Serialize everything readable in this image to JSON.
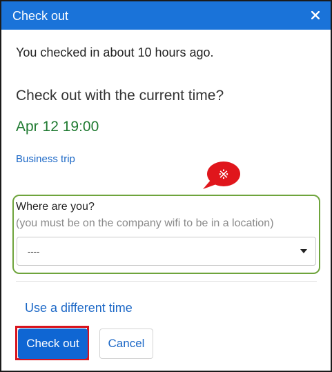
{
  "dialog": {
    "title": "Check out",
    "close_icon": "close-icon",
    "accent_color": "#1a73d9"
  },
  "body": {
    "checked_in_message": "You checked in about 10 hours ago.",
    "question": "Check out with the current time?",
    "current_time": "Apr 12 19:00",
    "business_trip_link": "Business trip"
  },
  "callout": {
    "symbol": "※",
    "color": "#e0161c"
  },
  "location": {
    "label": "Where are you?",
    "hint": "(you must be on the company wifi to be in a location)",
    "selected_value": "----",
    "highlight_color": "#6ea43c"
  },
  "actions": {
    "different_time_link": "Use a different time",
    "check_out_button": "Check out",
    "cancel_button": "Cancel",
    "highlight_color": "#d8141e"
  }
}
